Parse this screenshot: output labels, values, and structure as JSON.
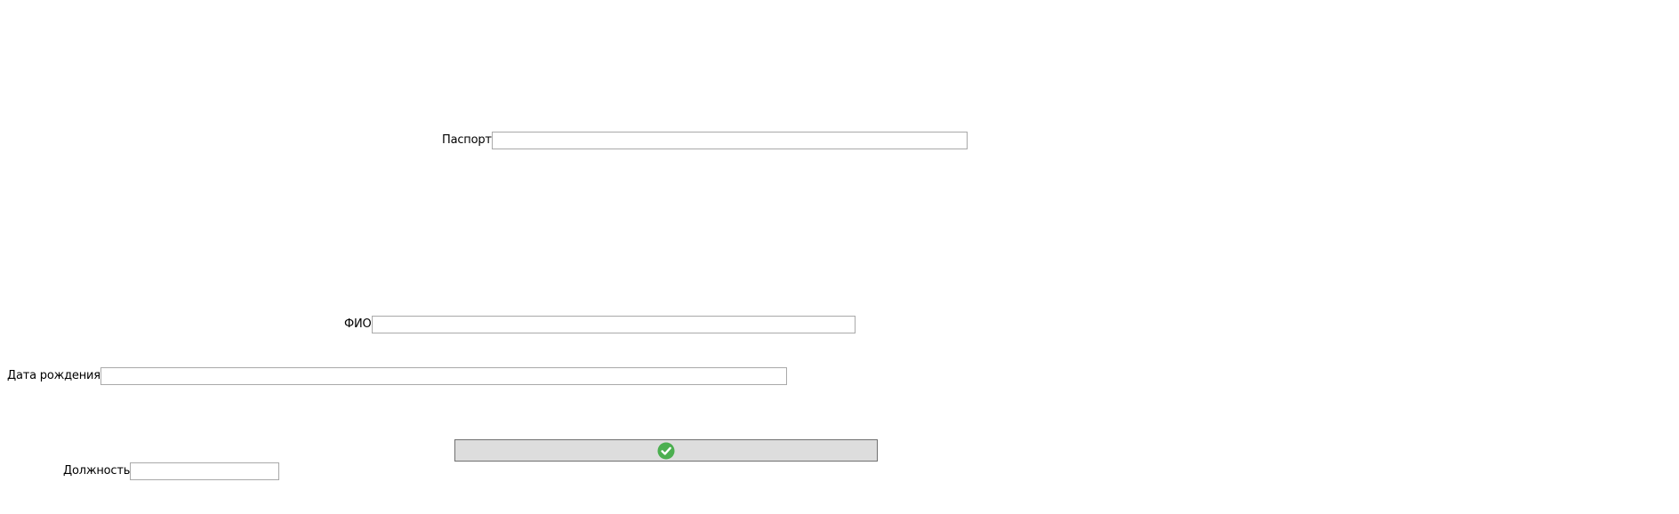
{
  "form": {
    "passport": {
      "label": "Паспорт",
      "value": ""
    },
    "full_name": {
      "label": "ФИО",
      "value": ""
    },
    "birth_date": {
      "label": "Дата рождения",
      "value": ""
    },
    "position": {
      "label": "Должность",
      "value": ""
    }
  },
  "confirm_button": {
    "icon": "checkmark-icon",
    "icon_color": "#4caf50"
  },
  "colors": {
    "button_bg": "#dddddd",
    "input_border": "#a9a9a9"
  }
}
